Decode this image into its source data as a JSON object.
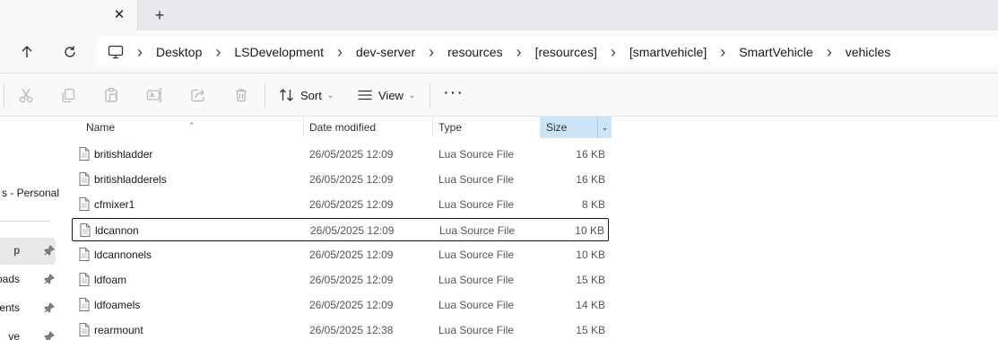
{
  "tab": {
    "close_glyph": "✕",
    "new_glyph": "+"
  },
  "breadcrumb": [
    "Desktop",
    "LSDevelopment",
    "dev-server",
    "resources",
    "[resources]",
    "[smartvehicle]",
    "SmartVehicle",
    "vehicles"
  ],
  "commandbar": {
    "sort_label": "Sort",
    "view_label": "View",
    "more_label": "···",
    "icons": [
      "cut-icon",
      "copy-icon",
      "paste-icon",
      "rename-icon",
      "share-icon",
      "delete-icon"
    ]
  },
  "sidebar": {
    "personal_label": "s - Personal",
    "items": [
      {
        "label": "p",
        "selected": true
      },
      {
        "label": "oads",
        "selected": false
      },
      {
        "label": "ents",
        "selected": false
      },
      {
        "label": "ve",
        "selected": false
      }
    ]
  },
  "columns": {
    "name": "Name",
    "date": "Date modified",
    "type": "Type",
    "size": "Size"
  },
  "files": [
    {
      "name": "britishladder",
      "date": "26/05/2025 12:09",
      "type": "Lua Source File",
      "size": "16 KB",
      "focused": false
    },
    {
      "name": "britishladderels",
      "date": "26/05/2025 12:09",
      "type": "Lua Source File",
      "size": "16 KB",
      "focused": false
    },
    {
      "name": "cfmixer1",
      "date": "26/05/2025 12:09",
      "type": "Lua Source File",
      "size": "8 KB",
      "focused": false
    },
    {
      "name": "ldcannon",
      "date": "26/05/2025 12:09",
      "type": "Lua Source File",
      "size": "10 KB",
      "focused": true
    },
    {
      "name": "ldcannonels",
      "date": "26/05/2025 12:09",
      "type": "Lua Source File",
      "size": "10 KB",
      "focused": false
    },
    {
      "name": "ldfoam",
      "date": "26/05/2025 12:09",
      "type": "Lua Source File",
      "size": "15 KB",
      "focused": false
    },
    {
      "name": "ldfoamels",
      "date": "26/05/2025 12:09",
      "type": "Lua Source File",
      "size": "14 KB",
      "focused": false
    },
    {
      "name": "rearmount",
      "date": "26/05/2025 12:38",
      "type": "Lua Source File",
      "size": "15 KB",
      "focused": false
    }
  ]
}
